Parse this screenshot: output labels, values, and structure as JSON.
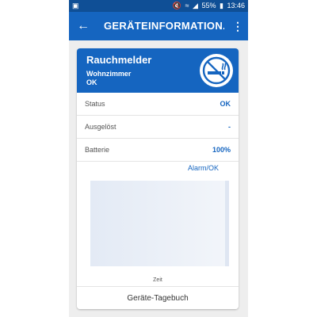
{
  "status_bar": {
    "battery": "55%",
    "time": "13:46",
    "icons": [
      "image-icon",
      "mute-icon",
      "wifi-icon",
      "signal-icon",
      "battery-icon"
    ]
  },
  "app_bar": {
    "title": "GERÄTEINFORMATION...",
    "back_icon": "arrow-left-icon",
    "menu_icon": "more-vert-icon"
  },
  "device": {
    "name": "Rauchmelder",
    "room": "Wohnzimmer",
    "state": "OK",
    "icon": "no-smoking-icon"
  },
  "details": [
    {
      "label": "Status",
      "value": "OK"
    },
    {
      "label": "Ausgelöst",
      "value": "-"
    },
    {
      "label": "Batterie",
      "value": "100%"
    }
  ],
  "chart_data": {
    "type": "area",
    "series": [
      {
        "name": "Alarm/OK",
        "values": []
      }
    ],
    "xlabel": "Zeit",
    "ylabel": "",
    "grid": false,
    "legend": "top-right"
  },
  "footer": {
    "button_label": "Geräte-Tagebuch"
  },
  "colors": {
    "primary": "#1565c0",
    "status_bar": "#0f4f96",
    "background": "#eeeeee",
    "chart_fill": "#e3eaf5"
  }
}
